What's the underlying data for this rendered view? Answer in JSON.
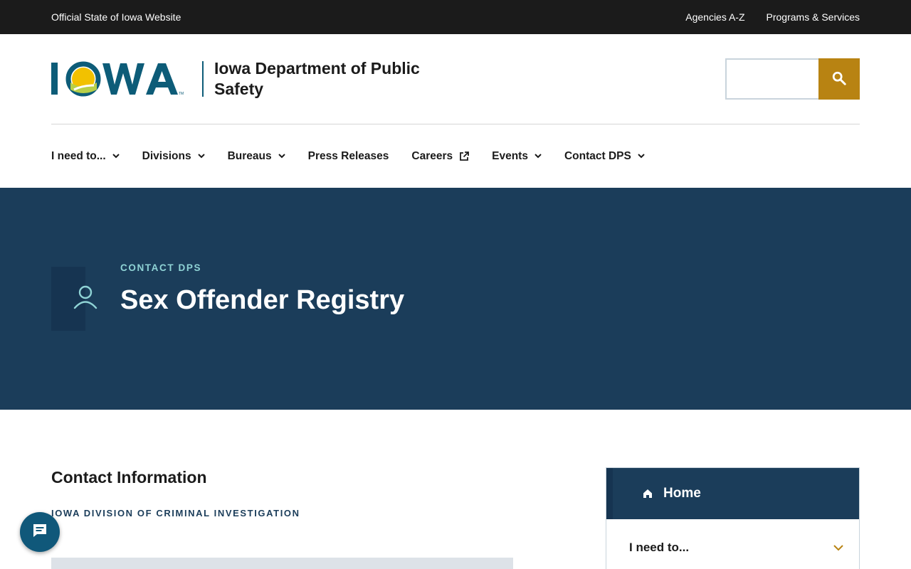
{
  "utility": {
    "official_text": "Official State of Iowa Website",
    "links": [
      "Agencies A-Z",
      "Programs & Services"
    ]
  },
  "header": {
    "logo_text": "IOWA",
    "agency_name": "Iowa Department of Public Safety",
    "search": {
      "value": "",
      "placeholder": "",
      "button_icon": "search-icon"
    }
  },
  "nav": {
    "items": [
      {
        "label": "I need to...",
        "icon": "chevron-down-icon"
      },
      {
        "label": "Divisions",
        "icon": "chevron-down-icon"
      },
      {
        "label": "Bureaus",
        "icon": "chevron-down-icon"
      },
      {
        "label": "Press Releases",
        "icon": ""
      },
      {
        "label": "Careers",
        "icon": "external-link-icon"
      },
      {
        "label": "Events",
        "icon": "chevron-down-icon"
      },
      {
        "label": "Contact DPS",
        "icon": "chevron-down-icon"
      }
    ]
  },
  "hero": {
    "icon": "person-icon",
    "eyebrow": "CONTACT DPS",
    "title": "Sex Offender Registry"
  },
  "content": {
    "heading": "Contact Information",
    "division": "IOWA DIVISION OF CRIMINAL INVESTIGATION"
  },
  "sidenav": {
    "home": "Home",
    "items": [
      {
        "label": "I need to...",
        "icon": "chevron-down-icon"
      }
    ]
  },
  "chat": {
    "icon": "chat-icon"
  },
  "colors": {
    "utility_bg": "#1b1b1b",
    "hero_bg": "#1b3d5a",
    "accent_gold": "#b88312",
    "teal": "#0d5c78",
    "eyebrow": "#8fd3d5"
  }
}
